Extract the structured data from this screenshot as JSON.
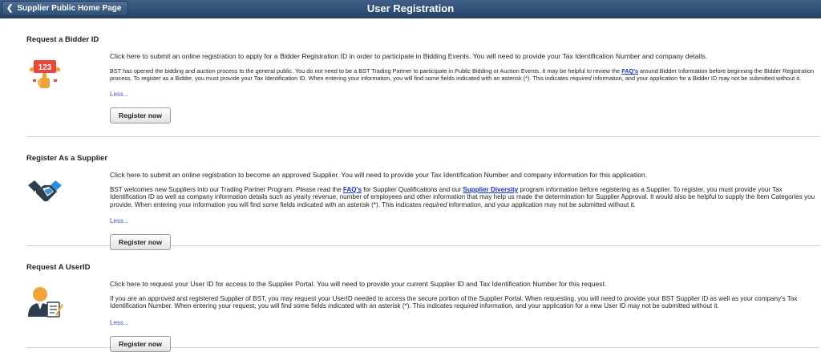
{
  "header": {
    "back_label": "Supplier Public Home Page",
    "title": "User Registration"
  },
  "sections": [
    {
      "title": "Request a Bidder ID",
      "icon": "bidder-paddle-icon",
      "badge": "123",
      "lead": "Click here to submit an online registration to apply for a Bidder Registration ID in order to participate in Bidding Events. You will need to provide your Tax Identification Number and company details.",
      "detail_a": "BST has opened the bidding and auction process to the general public. You do not need to be a BST Trading Partner to participate in Public Bidding or Auction Events. It may be helpful to review the ",
      "detail_link": "FAQ's",
      "detail_b": " around Bidder Information before beginning the Bidder Registration process.  To register as a Bidder, you must provide your Tax Identification ID. When entering your information, you will find some fields indicated with an asterisk (*). This indicates ",
      "detail_em": "required",
      "detail_c": " information, and your application for a Bidder ID may not be submitted without it.",
      "less": "Less...",
      "button": "Register now"
    },
    {
      "title": "Register As a Supplier",
      "icon": "handshake-icon",
      "lead": "Click here to submit an online registration to become an approved Supplier. You will need to provide your Tax Identification Number and company information for this application.",
      "detail_a": "BST welcomes new Suppliers into our Trading Partner Program. Please read the ",
      "detail_link": "FAQ's",
      "detail_b": " for Supplier Qualifications and our ",
      "detail_link2": "Supplier Diversity",
      "detail_c": " program information before registering as a Supplier. To register, you must provide your Tax Identification ID as well as company information details such as yearly revenue, number of employees and other information that may help us made the determination for Supplier Approval. It would also be helpful to supply the Item Categories you provide. When entering your information you will find some fields indicated with an asterisk (*). This indicates ",
      "detail_em": "required",
      "detail_d": " information, and your application may not be submitted without it.",
      "less": "Less...",
      "button": "Register now"
    },
    {
      "title": "Request A UserID",
      "icon": "user-form-icon",
      "lead": "Click here to request your User ID for access to the Supplier Portal. You will need to provide your current Supplier ID and Tax Identification Number for this request.",
      "detail_a": "If you are an approved and registered Supplier of BST, you may request your UserID needed to access the secure portion of the Supplier Portal. When requesting, you will need to provide your BST Supplier ID as well as your company's Tax Identification Number.    When entering your request, you will find some fields indicated with an asterisk (*). This indicates ",
      "detail_em": "required",
      "detail_b": " information, and your application for a new User ID may not be submitted without it.",
      "less": "Less...",
      "button": "Register now"
    }
  ],
  "colors": {
    "header_bg": "#26456b",
    "link": "#1a33cc",
    "bidder_red": "#e8473f",
    "bidder_orange": "#f0a33a",
    "handshake_dark": "#2f3e4e",
    "handshake_blue": "#2f8fd8",
    "user_orange": "#f0a33a",
    "user_dark": "#2f3e4e"
  }
}
